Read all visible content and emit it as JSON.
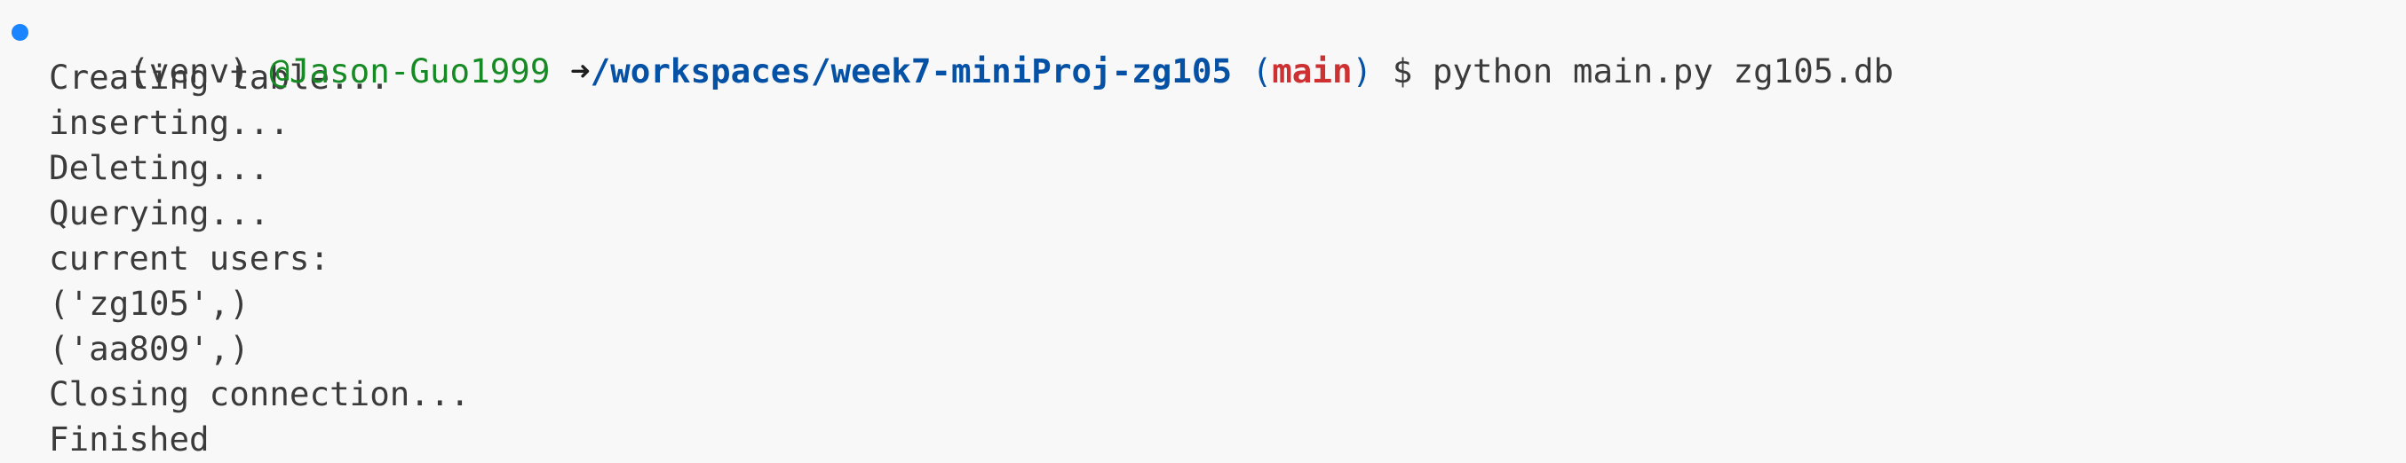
{
  "colors": {
    "background": "#f8f8f8",
    "foreground": "#3b3b3b",
    "user": "#168a24",
    "path": "#0451a5",
    "branch": "#cd3131",
    "decoration": "#1a85ff"
  },
  "prompt": {
    "decoration_icon": "command-status-circle-icon",
    "venv": "(venv)",
    "user": "@Jason-Guo1999",
    "arrow": "➜",
    "path": "/workspaces/week7-miniProj-zg105",
    "branch_open": "(",
    "branch": "main",
    "branch_close": ")",
    "dollar": "$",
    "command": "python main.py zg105.db"
  },
  "output": [
    "Creating table...",
    "inserting...",
    "Deleting...",
    "Querying...",
    "current users:",
    "('zg105',)",
    "('aa809',)",
    "Closing connection...",
    "Finished"
  ]
}
